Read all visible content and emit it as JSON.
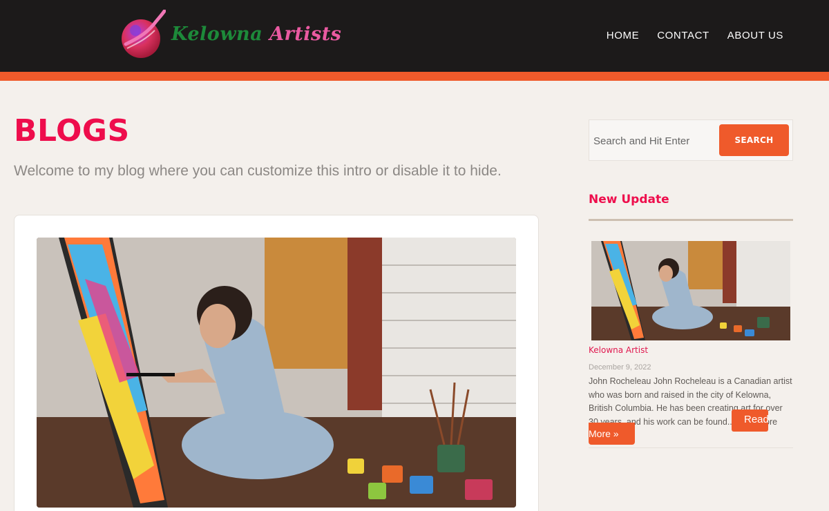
{
  "header": {
    "logo_word1": "Kelowna",
    "logo_word2": "Artists",
    "nav": [
      "HOME",
      "CONTACT",
      "ABOUT US"
    ]
  },
  "main": {
    "title": "BLOGS",
    "intro": "Welcome to my blog where you can customize this intro or disable it to hide."
  },
  "sidebar": {
    "search_placeholder": "Search and Hit Enter",
    "search_button": "SEARCH",
    "widget_title": "New Update",
    "post": {
      "category": "Kelowna Artist",
      "date": "December 9, 2022",
      "excerpt": "John Rocheleau John Rocheleau is a Canadian artist who was born and raised in the city of Kelowna, British Columbia. He has been creating art for over 30 years, and his work can be found...Read More",
      "read_label_a": "Read",
      "read_label_b": "More »"
    }
  },
  "colors": {
    "accent": "#ef5a2b",
    "title": "#ee0d4c",
    "header_bg": "#1c1a1a",
    "logo_green": "#1d8a3a",
    "logo_pink": "#ea5aa2"
  }
}
